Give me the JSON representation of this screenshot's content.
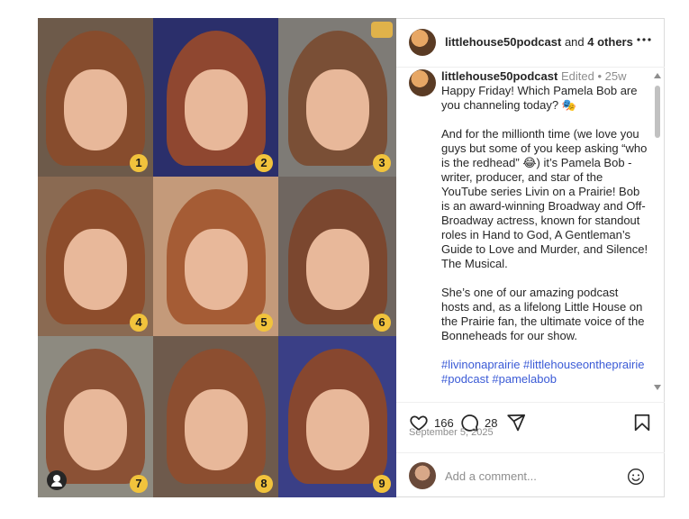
{
  "post": {
    "username": "littlehouse50podcast",
    "and_text": "and",
    "others": "4 others"
  },
  "caption": {
    "username": "littlehouse50podcast",
    "edited": "Edited",
    "dot": "•",
    "time": "25w",
    "para1": "Happy Friday! Which Pamela Bob are you channeling today? 🎭",
    "para2": "And for the millionth time (we love you guys but some of you keep asking “who is the redhead” 😂) it’s Pamela Bob - writer, producer, and star of the YouTube series Livin on a Prairie! Bob is an award-winning Broadway and Off-Broadway actress, known for standout roles in Hand to God, A Gentleman’s Guide to Love and Murder, and Silence! The Musical.",
    "para3": "She’s one of our amazing podcast hosts and, as a lifelong Little House on the Prairie fan, the ultimate voice of the Bonneheads for our show.",
    "hashtags": "#livinonaprairie #littlehouseontheprairie #podcast #pamelabob"
  },
  "actions": {
    "likes": "166",
    "comments": "28"
  },
  "date": "September 5, 2025",
  "comment_box": {
    "placeholder": "Add a comment..."
  },
  "grid": [
    {
      "badge": "1",
      "bg": "#6d5a4a",
      "hair": "#8a4a2a"
    },
    {
      "badge": "2",
      "bg": "#2b2f6b",
      "hair": "#9a4a2a"
    },
    {
      "badge": "3",
      "bg": "#7e7b76",
      "hair": "#7a4a30"
    },
    {
      "badge": "4",
      "bg": "#8a6a52",
      "hair": "#8d4a28"
    },
    {
      "badge": "5",
      "bg": "#c49a7a",
      "hair": "#a2552e"
    },
    {
      "badge": "6",
      "bg": "#6f6660",
      "hair": "#7c442a"
    },
    {
      "badge": "7",
      "bg": "#8d8a80",
      "hair": "#8b4a2c"
    },
    {
      "badge": "8",
      "bg": "#6e5a4c",
      "hair": "#8f4c2e"
    },
    {
      "badge": "9",
      "bg": "#3a3f86",
      "hair": "#904826"
    }
  ],
  "colors": {
    "badge": "#f1c33c",
    "link": "#3b5bd6",
    "muted": "#8e8e8e"
  },
  "icons": [
    "heart-icon",
    "comment-icon",
    "share-icon",
    "bookmark-icon",
    "more-icon",
    "emoji-icon",
    "user-tag-icon"
  ]
}
